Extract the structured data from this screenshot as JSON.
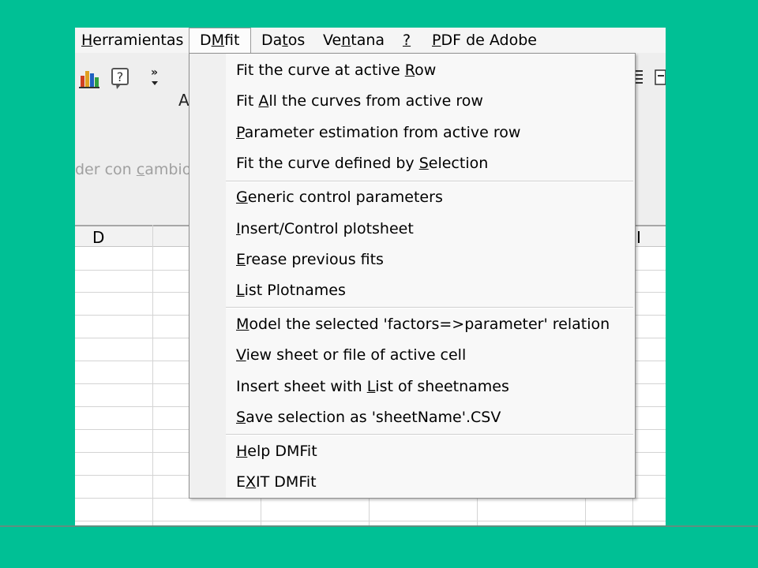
{
  "menubar": {
    "items": [
      {
        "pre": "",
        "ul": "H",
        "post": "erramientas"
      },
      {
        "pre": "D",
        "ul": "M",
        "post": "fit"
      },
      {
        "pre": "Da",
        "ul": "t",
        "post": "os"
      },
      {
        "pre": "Ve",
        "ul": "n",
        "post": "tana"
      },
      {
        "pre": "",
        "ul": "?",
        "post": ""
      },
      {
        "pre": "",
        "ul": "P",
        "post": "DF de Adobe"
      }
    ]
  },
  "toolbar": {
    "icons": [
      "chart-icon",
      "help-icon",
      "overflow-chevron-icon",
      "align-icon",
      "window-icon"
    ],
    "partial_letter": "A",
    "faded_text": {
      "pre": "der con ",
      "ul": "c",
      "post": "ambios"
    }
  },
  "sheet": {
    "columns": [
      "D",
      "I"
    ]
  },
  "dropdown": {
    "items": [
      {
        "pre": "Fit the curve at active ",
        "ul": "R",
        "post": "ow"
      },
      {
        "pre": "Fit ",
        "ul": "A",
        "post": "ll the curves from active row"
      },
      {
        "pre": "",
        "ul": "P",
        "post": "arameter estimation from active row"
      },
      {
        "pre": "Fit the curve defined by ",
        "ul": "S",
        "post": "election"
      },
      {
        "pre": "",
        "ul": "G",
        "post": "eneric control parameters"
      },
      {
        "pre": "",
        "ul": "I",
        "post": "nsert/Control plotsheet"
      },
      {
        "pre": "",
        "ul": "E",
        "post": "rease previous fits"
      },
      {
        "pre": "",
        "ul": "L",
        "post": "ist Plotnames"
      },
      {
        "pre": "",
        "ul": "M",
        "post": "odel the selected 'factors=>parameter' relation"
      },
      {
        "pre": "",
        "ul": "V",
        "post": "iew sheet or file of active cell"
      },
      {
        "pre": "Insert sheet with ",
        "ul": "L",
        "post": "ist of sheetnames"
      },
      {
        "pre": "",
        "ul": "S",
        "post": "ave selection as 'sheetName'.CSV"
      },
      {
        "pre": "",
        "ul": "H",
        "post": "elp DMFit"
      },
      {
        "pre": "E",
        "ul": "X",
        "post": "IT DMFit"
      }
    ]
  },
  "colors": {
    "background": "#00c095",
    "menu_bg": "#f8f8f8"
  }
}
